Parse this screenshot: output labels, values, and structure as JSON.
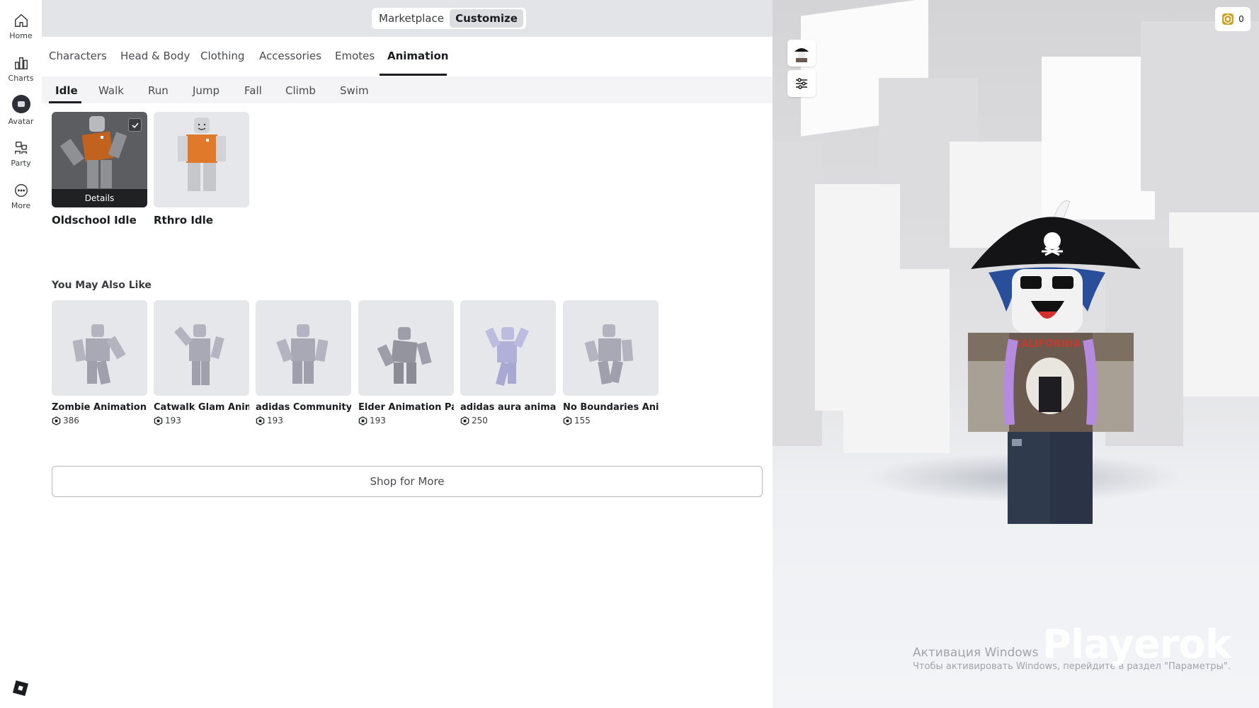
{
  "nav": {
    "items": [
      {
        "label": "Home",
        "icon": "home-icon"
      },
      {
        "label": "Charts",
        "icon": "charts-icon"
      },
      {
        "label": "Avatar",
        "icon": "avatar-icon"
      },
      {
        "label": "Party",
        "icon": "party-icon"
      },
      {
        "label": "More",
        "icon": "more-icon"
      }
    ],
    "active": "Avatar"
  },
  "mode_toggle": {
    "marketplace": "Marketplace",
    "customize": "Customize",
    "active": "Customize"
  },
  "tabs": [
    "Characters",
    "Head & Body",
    "Clothing",
    "Accessories",
    "Emotes",
    "Animation"
  ],
  "active_tab": "Animation",
  "subtabs": [
    "Idle",
    "Walk",
    "Run",
    "Jump",
    "Fall",
    "Climb",
    "Swim"
  ],
  "active_subtab": "Idle",
  "owned": [
    {
      "name": "Oldschool Idle",
      "selected": true,
      "overlay": "Details"
    },
    {
      "name": "Rthro Idle",
      "selected": false
    }
  ],
  "recommend": {
    "title": "You May Also Like",
    "items": [
      {
        "name": "Zombie Animation ...",
        "price": "386"
      },
      {
        "name": "Catwalk Glam Anim...",
        "price": "193"
      },
      {
        "name": "adidas Community ...",
        "price": "193"
      },
      {
        "name": "Elder Animation Pa...",
        "price": "193"
      },
      {
        "name": "adidas aura animati...",
        "price": "250"
      },
      {
        "name": "No Boundaries Ani...",
        "price": "155"
      }
    ]
  },
  "shop_button": "Shop for More",
  "robux_balance": "0",
  "watermark": {
    "activation_title": "Активация Windows",
    "activation_sub": "Чтобы активировать Windows, перейдите в раздел \"Параметры\".",
    "brand": "Playerok"
  },
  "colors": {
    "accent_dark": "#1b1c1f",
    "topbar": "#e3e4e7",
    "orange_shirt": "#e07a2a",
    "robux_gold": "#c9a227"
  }
}
